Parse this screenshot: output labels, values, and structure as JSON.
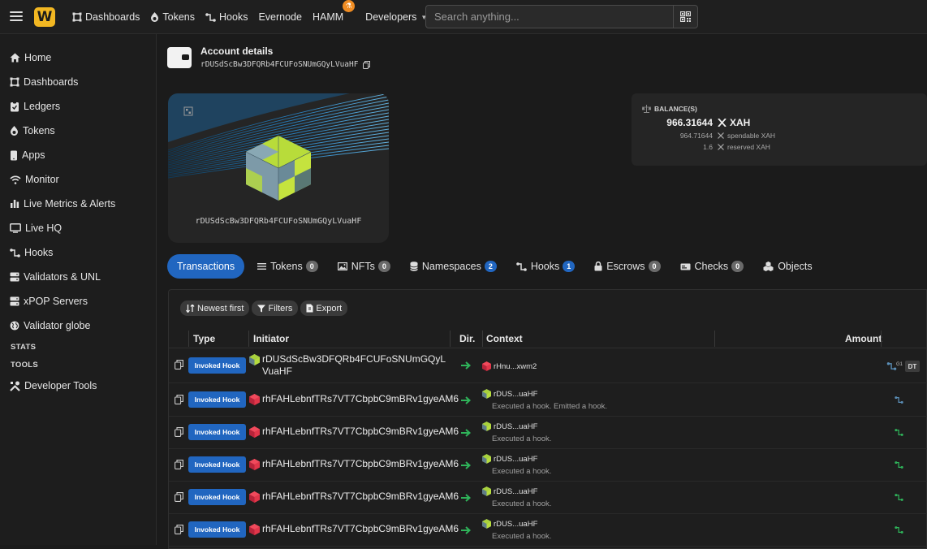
{
  "topbar": {
    "nav": [
      {
        "label": "Dashboards",
        "icon": "dashboard-icon"
      },
      {
        "label": "Tokens",
        "icon": "token-icon"
      },
      {
        "label": "Hooks",
        "icon": "hook-icon"
      },
      {
        "label": "Evernode",
        "icon": ""
      },
      {
        "label": "HAMM",
        "icon": "flask-icon"
      },
      {
        "label": "Developers",
        "icon": "chevron-down-icon"
      }
    ],
    "search_placeholder": "Search anything..."
  },
  "sidebar": {
    "items": [
      {
        "label": "Home",
        "icon": "home-icon"
      },
      {
        "label": "Dashboards",
        "icon": "dashboard-icon"
      },
      {
        "label": "Ledgers",
        "icon": "ledger-icon"
      },
      {
        "label": "Tokens",
        "icon": "token-icon"
      },
      {
        "label": "Apps",
        "icon": "phone-icon"
      },
      {
        "label": "Monitor",
        "icon": "wifi-icon"
      },
      {
        "label": "Live Metrics & Alerts",
        "icon": "bar-chart-icon"
      },
      {
        "label": "Live HQ",
        "icon": "monitor-icon"
      },
      {
        "label": "Hooks",
        "icon": "hook-icon"
      },
      {
        "label": "Validators & UNL",
        "icon": "server-icon"
      },
      {
        "label": "xPOP Servers",
        "icon": "server-icon"
      },
      {
        "label": "Validator globe",
        "icon": "globe-icon"
      }
    ],
    "section_stats": "STATS",
    "section_tools": "TOOLS",
    "tool_items": [
      {
        "label": "Developer Tools",
        "icon": "tools-icon"
      }
    ]
  },
  "account": {
    "title": "Account details",
    "address": "rDUSdScBw3DFQRb4FCUFoSNUmGQyLVuaHF"
  },
  "balance": {
    "label": "BALANCE(S)",
    "total": "966.31644",
    "currency": "XAH",
    "spendable": "964.71644",
    "spendable_label": "spendable XAH",
    "reserved": "1.6",
    "reserved_label": "reserved XAH"
  },
  "tabs": [
    {
      "label": "Transactions",
      "count": null,
      "active": true,
      "icon": ""
    },
    {
      "label": "Tokens",
      "count": "0",
      "active": false,
      "icon": "list-icon"
    },
    {
      "label": "NFTs",
      "count": "0",
      "active": false,
      "icon": "image-icon"
    },
    {
      "label": "Namespaces",
      "count": "2",
      "active": false,
      "icon": "database-icon"
    },
    {
      "label": "Hooks",
      "count": "1",
      "active": false,
      "icon": "hook-icon"
    },
    {
      "label": "Escrows",
      "count": "0",
      "active": false,
      "icon": "lock-icon"
    },
    {
      "label": "Checks",
      "count": "0",
      "active": false,
      "icon": "check-card-icon"
    },
    {
      "label": "Objects",
      "count": null,
      "active": false,
      "icon": "cubes-icon"
    }
  ],
  "filters": {
    "sort": "Newest first",
    "filters": "Filters",
    "export": "Export"
  },
  "table": {
    "columns": {
      "type": "Type",
      "initiator": "Initiator",
      "dir": "Dir.",
      "context": "Context",
      "amount": "Amount"
    },
    "rows": [
      {
        "type": "Invoked Hook",
        "initiator": "rDUSdScBw3DFQRb4FCUFoSNUmGQyLVuaHF",
        "init_color": "green",
        "ctx_addr": "rHnu...xwm2",
        "ctx_color": "red",
        "ctx_desc": "",
        "first": true
      },
      {
        "type": "Invoked Hook",
        "initiator": "rhFAHLebnfTRs7VT7CbpbC9mBRv1gyeAM6",
        "init_color": "red",
        "ctx_addr": "rDUS...uaHF",
        "ctx_color": "green",
        "ctx_desc": "Executed a hook. Emitted a hook.",
        "first": false
      },
      {
        "type": "Invoked Hook",
        "initiator": "rhFAHLebnfTRs7VT7CbpbC9mBRv1gyeAM6",
        "init_color": "red",
        "ctx_addr": "rDUS...uaHF",
        "ctx_color": "green",
        "ctx_desc": "Executed a hook.",
        "first": false
      },
      {
        "type": "Invoked Hook",
        "initiator": "rhFAHLebnfTRs7VT7CbpbC9mBRv1gyeAM6",
        "init_color": "red",
        "ctx_addr": "rDUS...uaHF",
        "ctx_color": "green",
        "ctx_desc": "Executed a hook.",
        "first": false
      },
      {
        "type": "Invoked Hook",
        "initiator": "rhFAHLebnfTRs7VT7CbpbC9mBRv1gyeAM6",
        "init_color": "red",
        "ctx_addr": "rDUS...uaHF",
        "ctx_color": "green",
        "ctx_desc": "Executed a hook.",
        "first": false
      },
      {
        "type": "Invoked Hook",
        "initiator": "rhFAHLebnfTRs7VT7CbpbC9mBRv1gyeAM6",
        "init_color": "red",
        "ctx_addr": "rDUS...uaHF",
        "ctx_color": "green",
        "ctx_desc": "Executed a hook.",
        "first": false
      }
    ],
    "first_row_badge": "DT",
    "first_row_sup": "G1"
  },
  "colors": {
    "accent": "#2166c0",
    "logo": "#f2b722",
    "green_arrow": "#2fb45a",
    "cube_green": "#9ccb3b",
    "cube_red": "#e2364a"
  }
}
